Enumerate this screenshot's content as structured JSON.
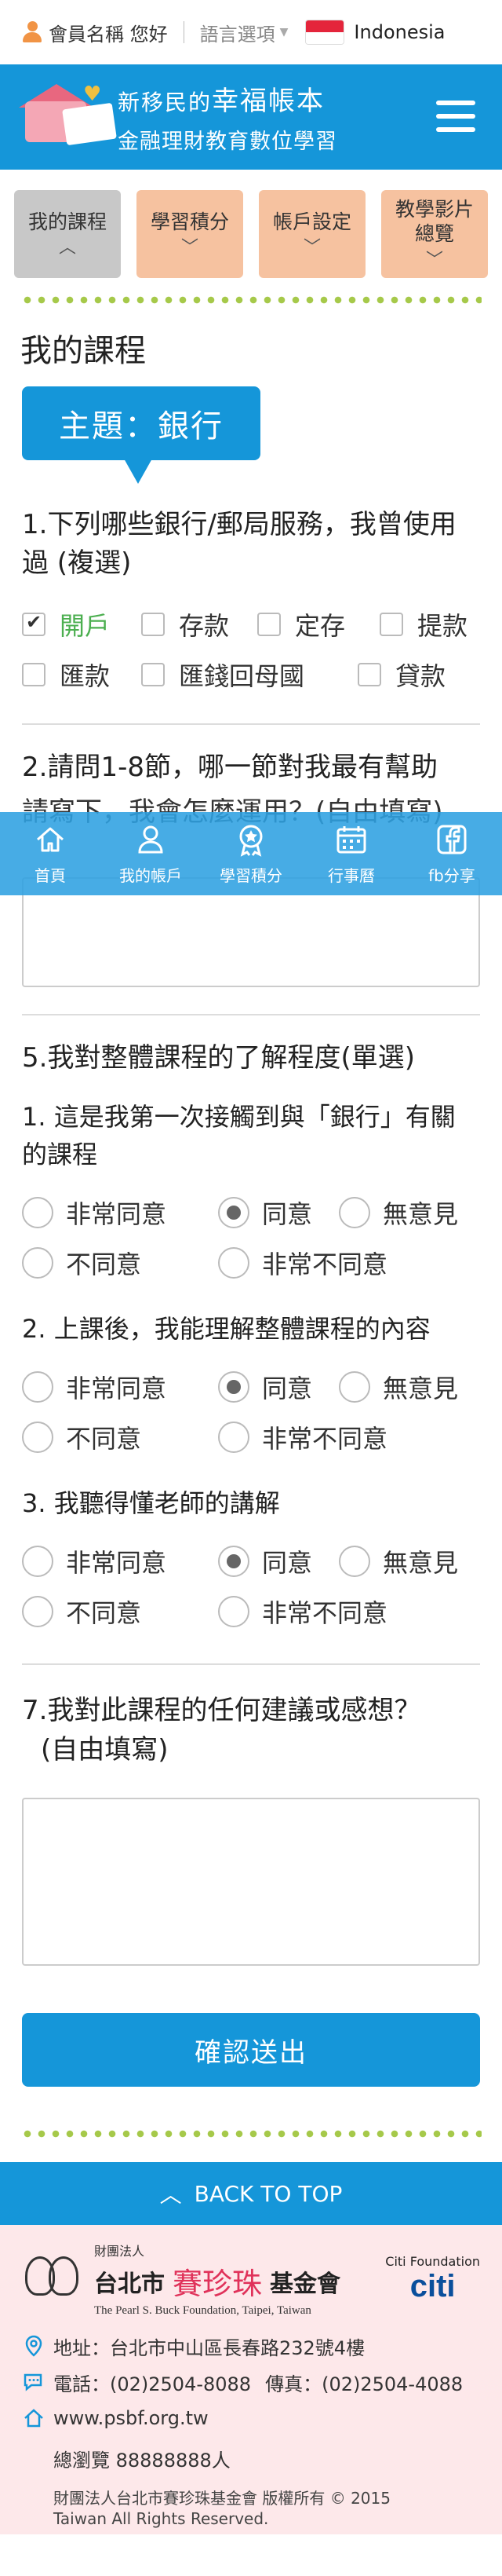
{
  "topbar": {
    "user_label": "會員名稱 您好",
    "lang_label": "語言選項",
    "lang_value": "Indonesia"
  },
  "header": {
    "logo_text": "幸福帳本",
    "title_prefix": "新移民的",
    "title_main": "幸福帳本",
    "subtitle": "金融理財教育數位學習"
  },
  "tabs": [
    {
      "label": "我的課程",
      "active": true
    },
    {
      "label": "學習積分"
    },
    {
      "label": "帳戶設定"
    },
    {
      "label": "教學影片\n總覽"
    }
  ],
  "page_title": "我的課程",
  "topic": "主題：銀行",
  "q1": {
    "title": "1.下列哪些銀行/郵局服務，我曾使用過 (複選)",
    "options": [
      "開戶",
      "存款",
      "定存",
      "提款",
      "匯款",
      "匯錢回母國",
      "貸款"
    ],
    "checked": "開戶"
  },
  "q2": {
    "title": "2.請問1-8節，哪一節對我最有幫助",
    "prompt": "請寫下，我會怎麼運用？(自由填寫)"
  },
  "nav": [
    {
      "label": "首頁",
      "icon": "home-icon"
    },
    {
      "label": "我的帳戶",
      "icon": "user-icon"
    },
    {
      "label": "學習積分",
      "icon": "badge-icon"
    },
    {
      "label": "行事曆",
      "icon": "calendar-icon"
    },
    {
      "label": "fb分享",
      "icon": "facebook-icon"
    }
  ],
  "q5": {
    "title": "5.我對整體課程的了解程度(單選)",
    "choices": [
      "非常同意",
      "同意",
      "無意見",
      "不同意",
      "非常不同意"
    ],
    "items": [
      {
        "text": "1. 這是我第一次接觸到與「銀行」有關的課程",
        "selected": "同意"
      },
      {
        "text": "2. 上課後，我能理解整體課程的內容",
        "selected": "同意"
      },
      {
        "text": "3. 我聽得懂老師的講解",
        "selected": "同意"
      }
    ]
  },
  "q7": {
    "title": "7.我對此課程的任何建議或感想？",
    "sub": "(自由填寫)"
  },
  "submit_label": "確認送出",
  "back_to_top": "BACK TO TOP",
  "footer": {
    "org_small": "財團法人",
    "org_city": "台北市",
    "org_name": "賽珍珠",
    "org_suffix": "基金會",
    "org_en": "The Pearl S. Buck Foundation, Taipei, Taiwan",
    "citi_foundation": "Citi Foundation",
    "citi_word": "citi",
    "address": "地址：台北市中山區長春路232號4樓",
    "phone": "電話：(02)2504-8088",
    "fax": "傳真：(02)2504-4088",
    "website": "www.psbf.org.tw",
    "visits": "總瀏覽 88888888人",
    "copyright_1": "財團法人台北市賽珍珠基金會 版權所有 © 2015",
    "copyright_2": "Taiwan All Rights Reserved."
  },
  "colors": {
    "brand_blue": "#1596d9",
    "tab_peach": "#f6c2a0",
    "tab_active": "#c8c8c8",
    "checked_green": "#4caf50",
    "footer_pink": "#fde8ea"
  }
}
